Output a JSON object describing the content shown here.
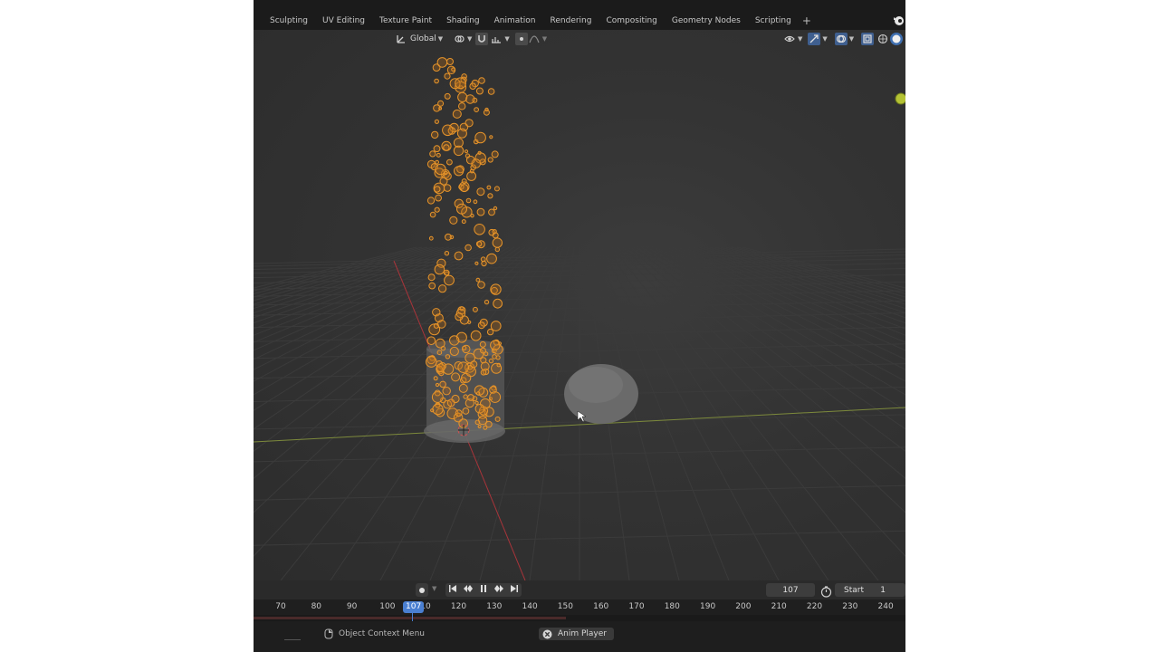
{
  "workspace_tabs": [
    "Sculpting",
    "UV Editing",
    "Texture Paint",
    "Shading",
    "Animation",
    "Rendering",
    "Compositing",
    "Geometry Nodes",
    "Scripting"
  ],
  "add_tab_label": "+",
  "viewport_header": {
    "transform_orientation": "Global"
  },
  "timeline": {
    "current_frame": "107",
    "current_frame_field": "107",
    "start_label": "Start",
    "start_value": "1",
    "ticks": [
      "70",
      "80",
      "90",
      "100",
      "110",
      "120",
      "130",
      "140",
      "150",
      "160",
      "170",
      "180",
      "190",
      "200",
      "210",
      "220",
      "230",
      "240"
    ]
  },
  "statusbar": {
    "context_menu_label": "Object Context Menu",
    "anim_player_label": "Anim Player"
  },
  "colors": {
    "accent_blue": "#4a7fd1",
    "particle_orange": "#e8952a",
    "x_axis_red": "#a8343a",
    "y_axis_green": "#8aa83a"
  }
}
